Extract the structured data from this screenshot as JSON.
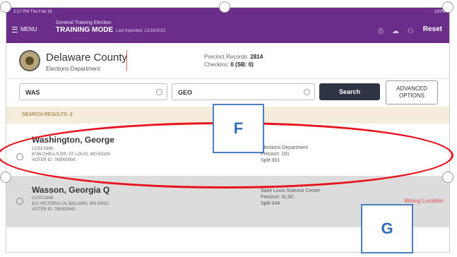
{
  "statusbar": {
    "time": "2:17 PM  Thu Feb 16",
    "battery": "100%"
  },
  "topbar": {
    "menu_label": "MENU",
    "title_line1": "General Training Election",
    "title_mode": "TRAINING MODE",
    "last_imported": "Last Imported: 12/16/2023",
    "reset_label": "Reset"
  },
  "header": {
    "county": "Delaware County",
    "department": "Elections Department",
    "precinct_label": "Precinct Records:",
    "precinct_value": "2814",
    "checkins_label": "Checkins:",
    "checkins_value": "0 (SB: 0)"
  },
  "search": {
    "last_name_value": "WAS",
    "first_name_value": "GEO",
    "search_label": "Search",
    "advanced_line1": "ADVANCED",
    "advanced_line2": "OPTIONS"
  },
  "results": {
    "label": "SEARCH RESULTS: 2",
    "rows": [
      {
        "name": "Washington, George",
        "dob": "12/31/1988",
        "address": "8748 CHELLS DR, ST LOUIS, MO 63104",
        "voter_id": "VOTER ID: 765000006",
        "location_name": "Elections Department",
        "precinct": "Precinct: 161",
        "split": "Split 001",
        "status": ""
      },
      {
        "name": "Wasson, Georgia Q",
        "dob": "01/07/1948",
        "address": "612 VICTORIA LN, BALLWIN, MO 63021",
        "voter_id": "VOTER ID: 765000843",
        "location_name": "Saint Louis Science Center",
        "precinct": "Precinct: SLSC",
        "split": "Split 044",
        "status": "Wrong Location"
      }
    ]
  },
  "annotations": {
    "callout_f": "F",
    "callout_g": "G"
  },
  "colors": {
    "header_purple": "#6a2e8a",
    "highlight_red": "#e8121d",
    "callout_blue": "#4a7fc1",
    "warning_red": "#e24a4a"
  }
}
